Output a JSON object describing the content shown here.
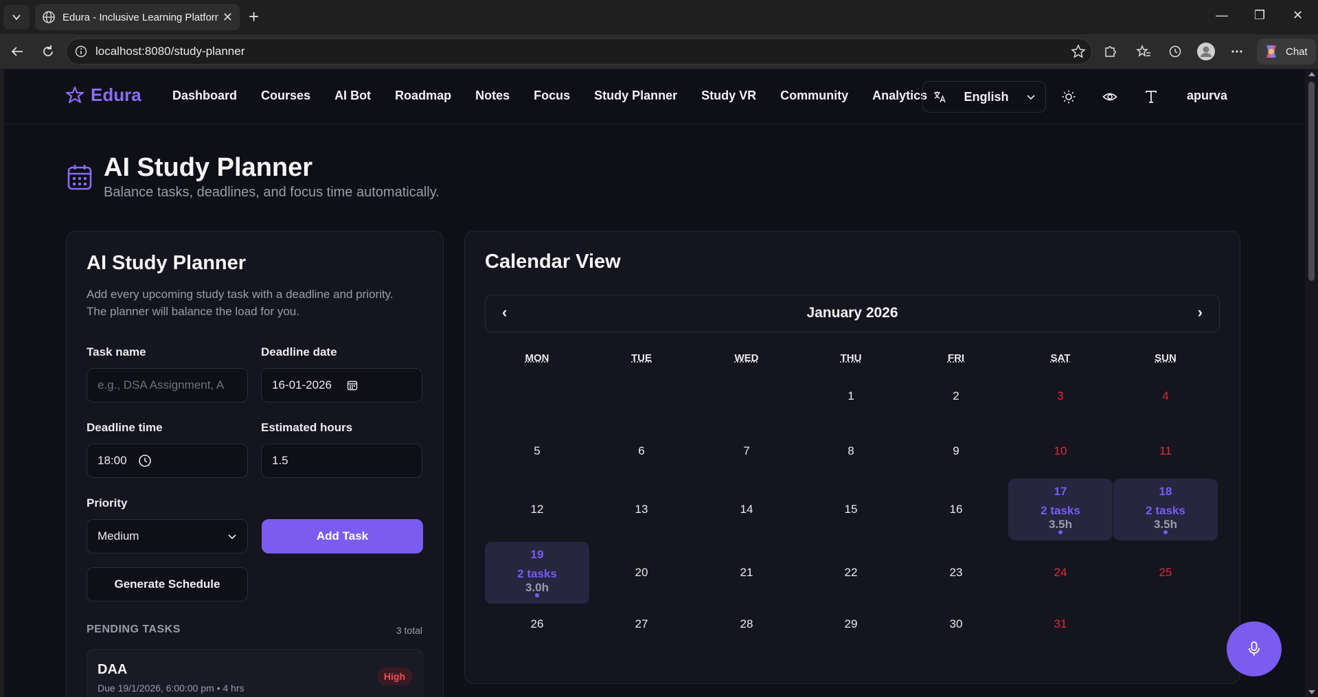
{
  "browser": {
    "tab_title": "Edura - Inclusive Learning Platform",
    "url": "localhost:8080/study-planner",
    "chat_label": "Chat"
  },
  "nav": {
    "brand": "Edura",
    "links": [
      "Dashboard",
      "Courses",
      "AI Bot",
      "Roadmap",
      "Notes",
      "Focus",
      "Study Planner",
      "Study VR",
      "Community",
      "Analytics"
    ],
    "language": "English",
    "user": "apurva"
  },
  "hero": {
    "title": "AI Study Planner",
    "subtitle": "Balance tasks, deadlines, and focus time automatically."
  },
  "planner": {
    "title": "AI Study Planner",
    "description": "Add every upcoming study task with a deadline and priority. The planner will balance the load for you.",
    "task_name_label": "Task name",
    "task_name_placeholder": "e.g., DSA Assignment, A",
    "deadline_date_label": "Deadline date",
    "deadline_date_value": "16-01-2026",
    "deadline_time_label": "Deadline time",
    "deadline_time_value": "18:00",
    "est_hours_label": "Estimated hours",
    "est_hours_value": "1.5",
    "priority_label": "Priority",
    "priority_value": "Medium",
    "add_task": "Add Task",
    "generate": "Generate Schedule",
    "pending_heading": "PENDING TASKS",
    "pending_count": "3 total",
    "tasks": [
      {
        "name": "DAA",
        "meta": "Due 19/1/2026, 6:00:00 pm • 4 hrs",
        "priority": "High"
      }
    ]
  },
  "calendar": {
    "title": "Calendar View",
    "month": "January 2026",
    "prev": "‹",
    "next": "›",
    "weekdays": [
      "MON",
      "TUE",
      "WED",
      "THU",
      "FRI",
      "SAT",
      "SUN"
    ],
    "days": {
      "17": {
        "tasks": "2 tasks",
        "hours": "3.5h"
      },
      "18": {
        "tasks": "2 tasks",
        "hours": "3.5h"
      },
      "19": {
        "tasks": "2 tasks",
        "hours": "3.0h"
      }
    }
  },
  "colors": {
    "accent": "#7a5cf0",
    "weekend": "#e02b3a",
    "background": "#0f0f17"
  }
}
